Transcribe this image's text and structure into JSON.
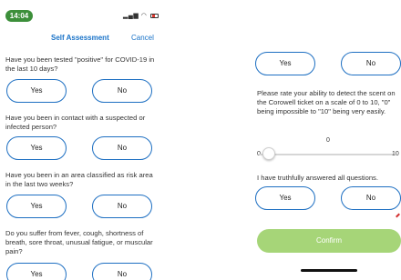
{
  "status_bar": {
    "time": "14:04",
    "time_color": "#3c8f3a"
  },
  "nav": {
    "title": "Self Assessment",
    "cancel": "Cancel",
    "accent": "#1a73c8"
  },
  "option_border_color": "#1d6fc2",
  "left_questions": [
    {
      "text": "Have you been tested \"positive\" for COVID-19 in the last 10 days?",
      "yes": "Yes",
      "no": "No"
    },
    {
      "text": "Have you been in contact with a suspected or infected person?",
      "yes": "Yes",
      "no": "No"
    },
    {
      "text": "Have you been in an area classified as risk area in the last two weeks?",
      "yes": "Yes",
      "no": "No"
    },
    {
      "text": "Do you suffer from fever, cough, shortness of breath, sore throat, unusual fatigue, or muscular pain?",
      "yes": "Yes",
      "no": "No"
    }
  ],
  "right": {
    "top_options": {
      "yes": "Yes",
      "no": "No"
    },
    "rating_question": "Please rate your ability to detect the scent on the Corowell ticket on a scale of 0 to 10, \"0\" being impossible to \"10\" being very easily.",
    "slider": {
      "value": "0",
      "min": "0",
      "max": "10",
      "level": 0
    },
    "truth_question": "I have truthfully answered all questions.",
    "truth_options": {
      "yes": "Yes",
      "no": "No"
    },
    "confirm": "Confirm",
    "confirm_color": "#a6d578"
  },
  "icons": [
    "signal-icon",
    "wifi-icon",
    "battery-icon"
  ]
}
